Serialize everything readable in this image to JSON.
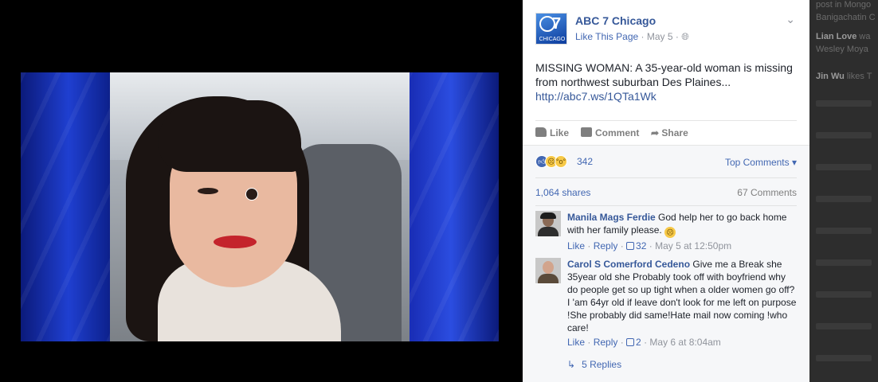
{
  "post": {
    "page_name": "ABC 7 Chicago",
    "avatar_text": "CHICAGO",
    "avatar_abc": "abc",
    "avatar_seven": "7",
    "like_page": "Like This Page",
    "date": "May 5",
    "text": "MISSING WOMAN: A 35-year-old woman is missing from northwest suburban Des Plaines...",
    "link": "http://abc7.ws/1QTa1Wk"
  },
  "actions": {
    "like": "Like",
    "comment": "Comment",
    "share": "Share"
  },
  "feedback": {
    "reaction_count": "342",
    "top_comments": "Top Comments",
    "shares": "1,064 shares",
    "comments_count": "67 Comments"
  },
  "comments": [
    {
      "name": "Manila Mags Ferdie",
      "text": "God help her to go back home with her family please.",
      "like": "Like",
      "reply": "Reply",
      "likes": "32",
      "time": "May 5 at 12:50pm"
    },
    {
      "name": "Carol S Comerford Cedeno",
      "text": "Give me a Break she 35year old she Probably took off with boyfriend why do people get so up tight when a older women go off?I 'am 64yr old if leave don't look for me left on purpose !She probably did same!Hate mail now coming !who care!",
      "like": "Like",
      "reply": "Reply",
      "likes": "2",
      "time": "May 6 at 8:04am"
    }
  ],
  "replies": "5 Replies",
  "ticker": [
    {
      "line1": "post in Mongo"
    },
    {
      "line1": "Banigachatin C"
    },
    {
      "name": "Lian Love",
      "line1": "wa"
    },
    {
      "line1": "Wesley Moya"
    },
    {
      "name": "Jin Wu",
      "line1": "likes T"
    }
  ]
}
